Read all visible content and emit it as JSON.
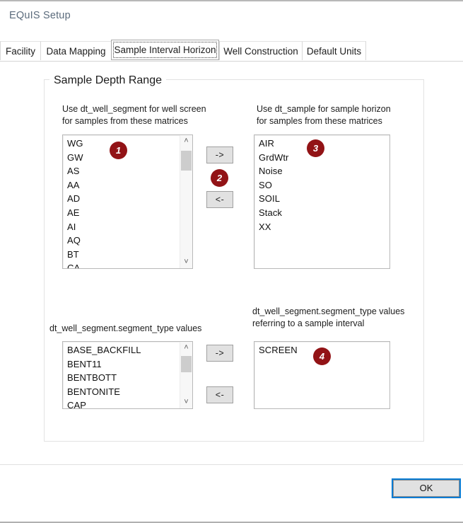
{
  "window": {
    "title": "EQuIS Setup"
  },
  "tabs": [
    {
      "label": "Facility",
      "selected": false
    },
    {
      "label": "Data Mapping",
      "selected": false
    },
    {
      "label": "Sample Interval Horizon",
      "selected": true
    },
    {
      "label": "Well Construction",
      "selected": false
    },
    {
      "label": "Default Units",
      "selected": false
    }
  ],
  "group": {
    "title": "Sample Depth Range"
  },
  "sections": {
    "well_screen": {
      "label_line1": "Use dt_well_segment for well screen",
      "label_line2": "for samples from these matrices",
      "items": [
        "WG",
        "GW",
        "AS",
        "AA",
        "AD",
        "AE",
        "AI",
        "AQ",
        "BT",
        "CA"
      ]
    },
    "sample_horizon": {
      "label_line1": "Use dt_sample for sample horizon",
      "label_line2": "for samples from these matrices",
      "items": [
        "AIR",
        "GrdWtr",
        "Noise",
        "SO",
        "SOIL",
        "Stack",
        "XX"
      ]
    },
    "segment_types": {
      "label_line1": "dt_well_segment.segment_type values",
      "items": [
        "BASE_BACKFILL",
        "BENT11",
        "BENTBOTT",
        "BENTONITE",
        "CAP"
      ]
    },
    "sample_interval_segments": {
      "label_line1": "dt_well_segment.segment_type values",
      "label_line2": "referring to a sample interval",
      "items": [
        "SCREEN"
      ]
    }
  },
  "buttons": {
    "move_right": "->",
    "move_left": "<-",
    "ok": "OK"
  },
  "badges": [
    {
      "number": "1"
    },
    {
      "number": "2"
    },
    {
      "number": "3"
    },
    {
      "number": "4"
    }
  ],
  "icons": {
    "scroll_up": "˄",
    "scroll_down": "˅"
  },
  "colors": {
    "badge": "#921316",
    "focus_outline": "#0a7cd4",
    "title_text": "#5b6b7c"
  }
}
